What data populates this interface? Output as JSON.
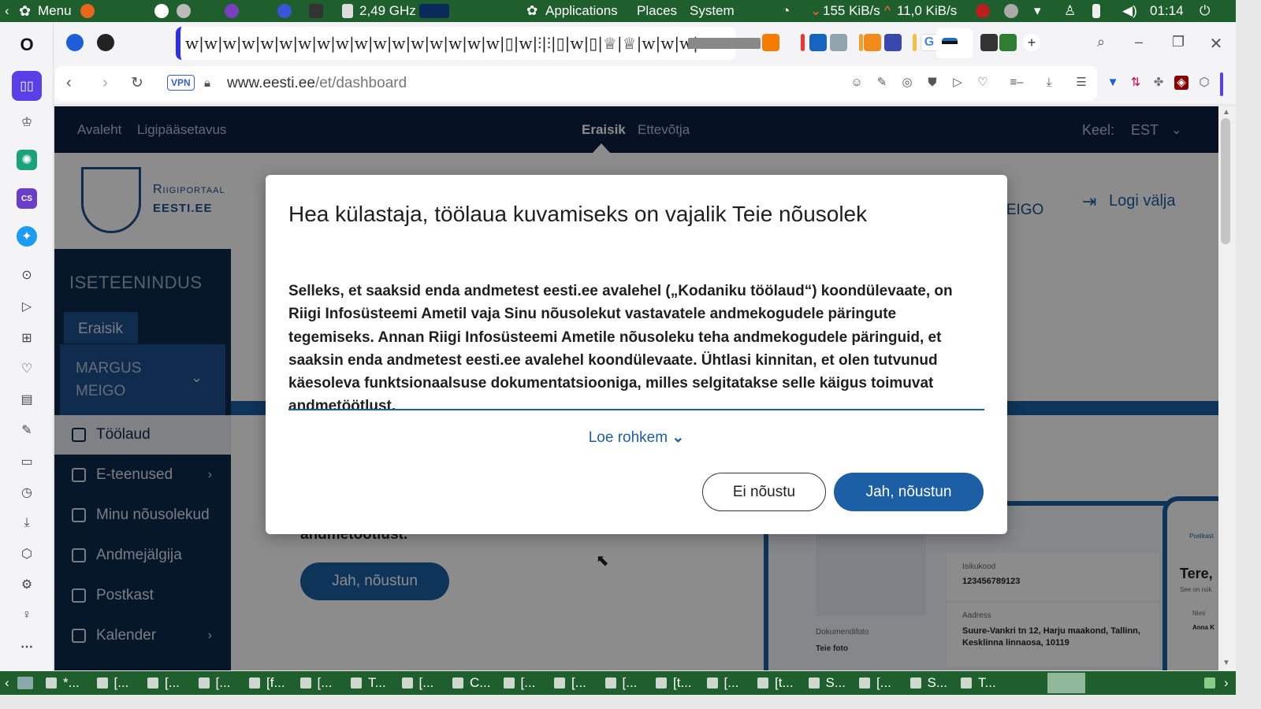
{
  "system_panel": {
    "menu_label": "Menu",
    "cpu_freq": "2,49 GHz",
    "applications": "Applications",
    "places": "Places",
    "system": "System",
    "net_down": "155 KiB/s",
    "net_up": "11,0 KiB/s",
    "clock": "01:14"
  },
  "browser": {
    "tab_strip_text": "w|w|w|w|w|w|w|w|w|w|w|w|w|w|w|w|w|▯|w|⫶|⫶|▯|w|▯|♕|♕|w|w|w|w",
    "vpn_label": "VPN",
    "url_domain": "www.eesti.ee",
    "url_path": "/et/dashboard"
  },
  "page": {
    "topnav": {
      "avaleht": "Avaleht",
      "ligipaasetavus": "Ligipääsetavus",
      "eraisik": "Eraisik",
      "ettevotja": "Ettevõtja",
      "keel_label": "Keel:",
      "keel_value": "EST"
    },
    "header": {
      "logo_line1": "Riigiportaal",
      "logo_line2": "EESTI.EE",
      "user_partial": "MEIGO",
      "logout": "Logi välja"
    },
    "sidebar": {
      "section_title": "ISETEENINDUS",
      "role_tab": "Eraisik",
      "user_name_line1": "MARGUS",
      "user_name_line2": "MEIGO",
      "items": [
        {
          "label": "Töölaud",
          "has_chevron": false
        },
        {
          "label": "E-teenused",
          "has_chevron": true
        },
        {
          "label": "Minu nõusolekud",
          "has_chevron": false
        },
        {
          "label": "Andmejälgija",
          "has_chevron": false
        },
        {
          "label": "Postkast",
          "has_chevron": false
        },
        {
          "label": "Kalender",
          "has_chevron": true
        }
      ]
    },
    "background_content": {
      "partial_text": "andmetöötlust.",
      "accept_button": "Jah, nõustun",
      "id_label": "Isikukood",
      "id_value": "123456789123",
      "address_label": "Aadress",
      "address_value": "Suure-Vankri tn 12, Harju maakond, Tallinn, Kesklinna linnaosa, 10119",
      "photo_label": "Dokumendifoto",
      "photo_value": "Teie foto",
      "greeting": "Tere,",
      "see_on": "See on nük",
      "postkast_mini": "Postkast",
      "name_mini_label": "Nimi",
      "name_mini_value": "Anna K"
    }
  },
  "modal": {
    "title": "Hea külastaja, töölaua kuvamiseks on vajalik Teie nõusolek",
    "body": "Selleks, et saaksid enda andmetest eesti.ee avalehel („Kodaniku töölaud“) koondülevaate, on Riigi Infosüsteemi Ametil vaja Sinu nõusolekut vastavatele andmekogudele päringute tegemiseks. Annan Riigi Infosüsteemi Ametile nõusoleku teha andmekogudele päringuid, et saaksin enda andmetest eesti.ee avalehel koondülevaate. Ühtlasi kinnitan, et olen tutvunud käesoleva funktsionaalsuse dokumentatsiooniga, milles selgitatakse selle käigus toimuvat andmetöötlust.",
    "read_more": "Loe rohkem",
    "decline": "Ei nõustu",
    "accept": "Jah, nõustun"
  },
  "taskbar": {
    "items": [
      "*...",
      "[...",
      "[...",
      "[...",
      "[f...",
      "[...",
      "T...",
      "[...",
      "C...",
      "[...",
      "[...",
      "[...",
      "[t...",
      "[...",
      "[t...",
      "S...",
      "[...",
      "S...",
      "T..."
    ]
  },
  "colors": {
    "navy": "#0b2040",
    "sidebar": "#0d2a4e",
    "accent_blue": "#1c5fa4",
    "system_green": "#1f5f2e"
  }
}
